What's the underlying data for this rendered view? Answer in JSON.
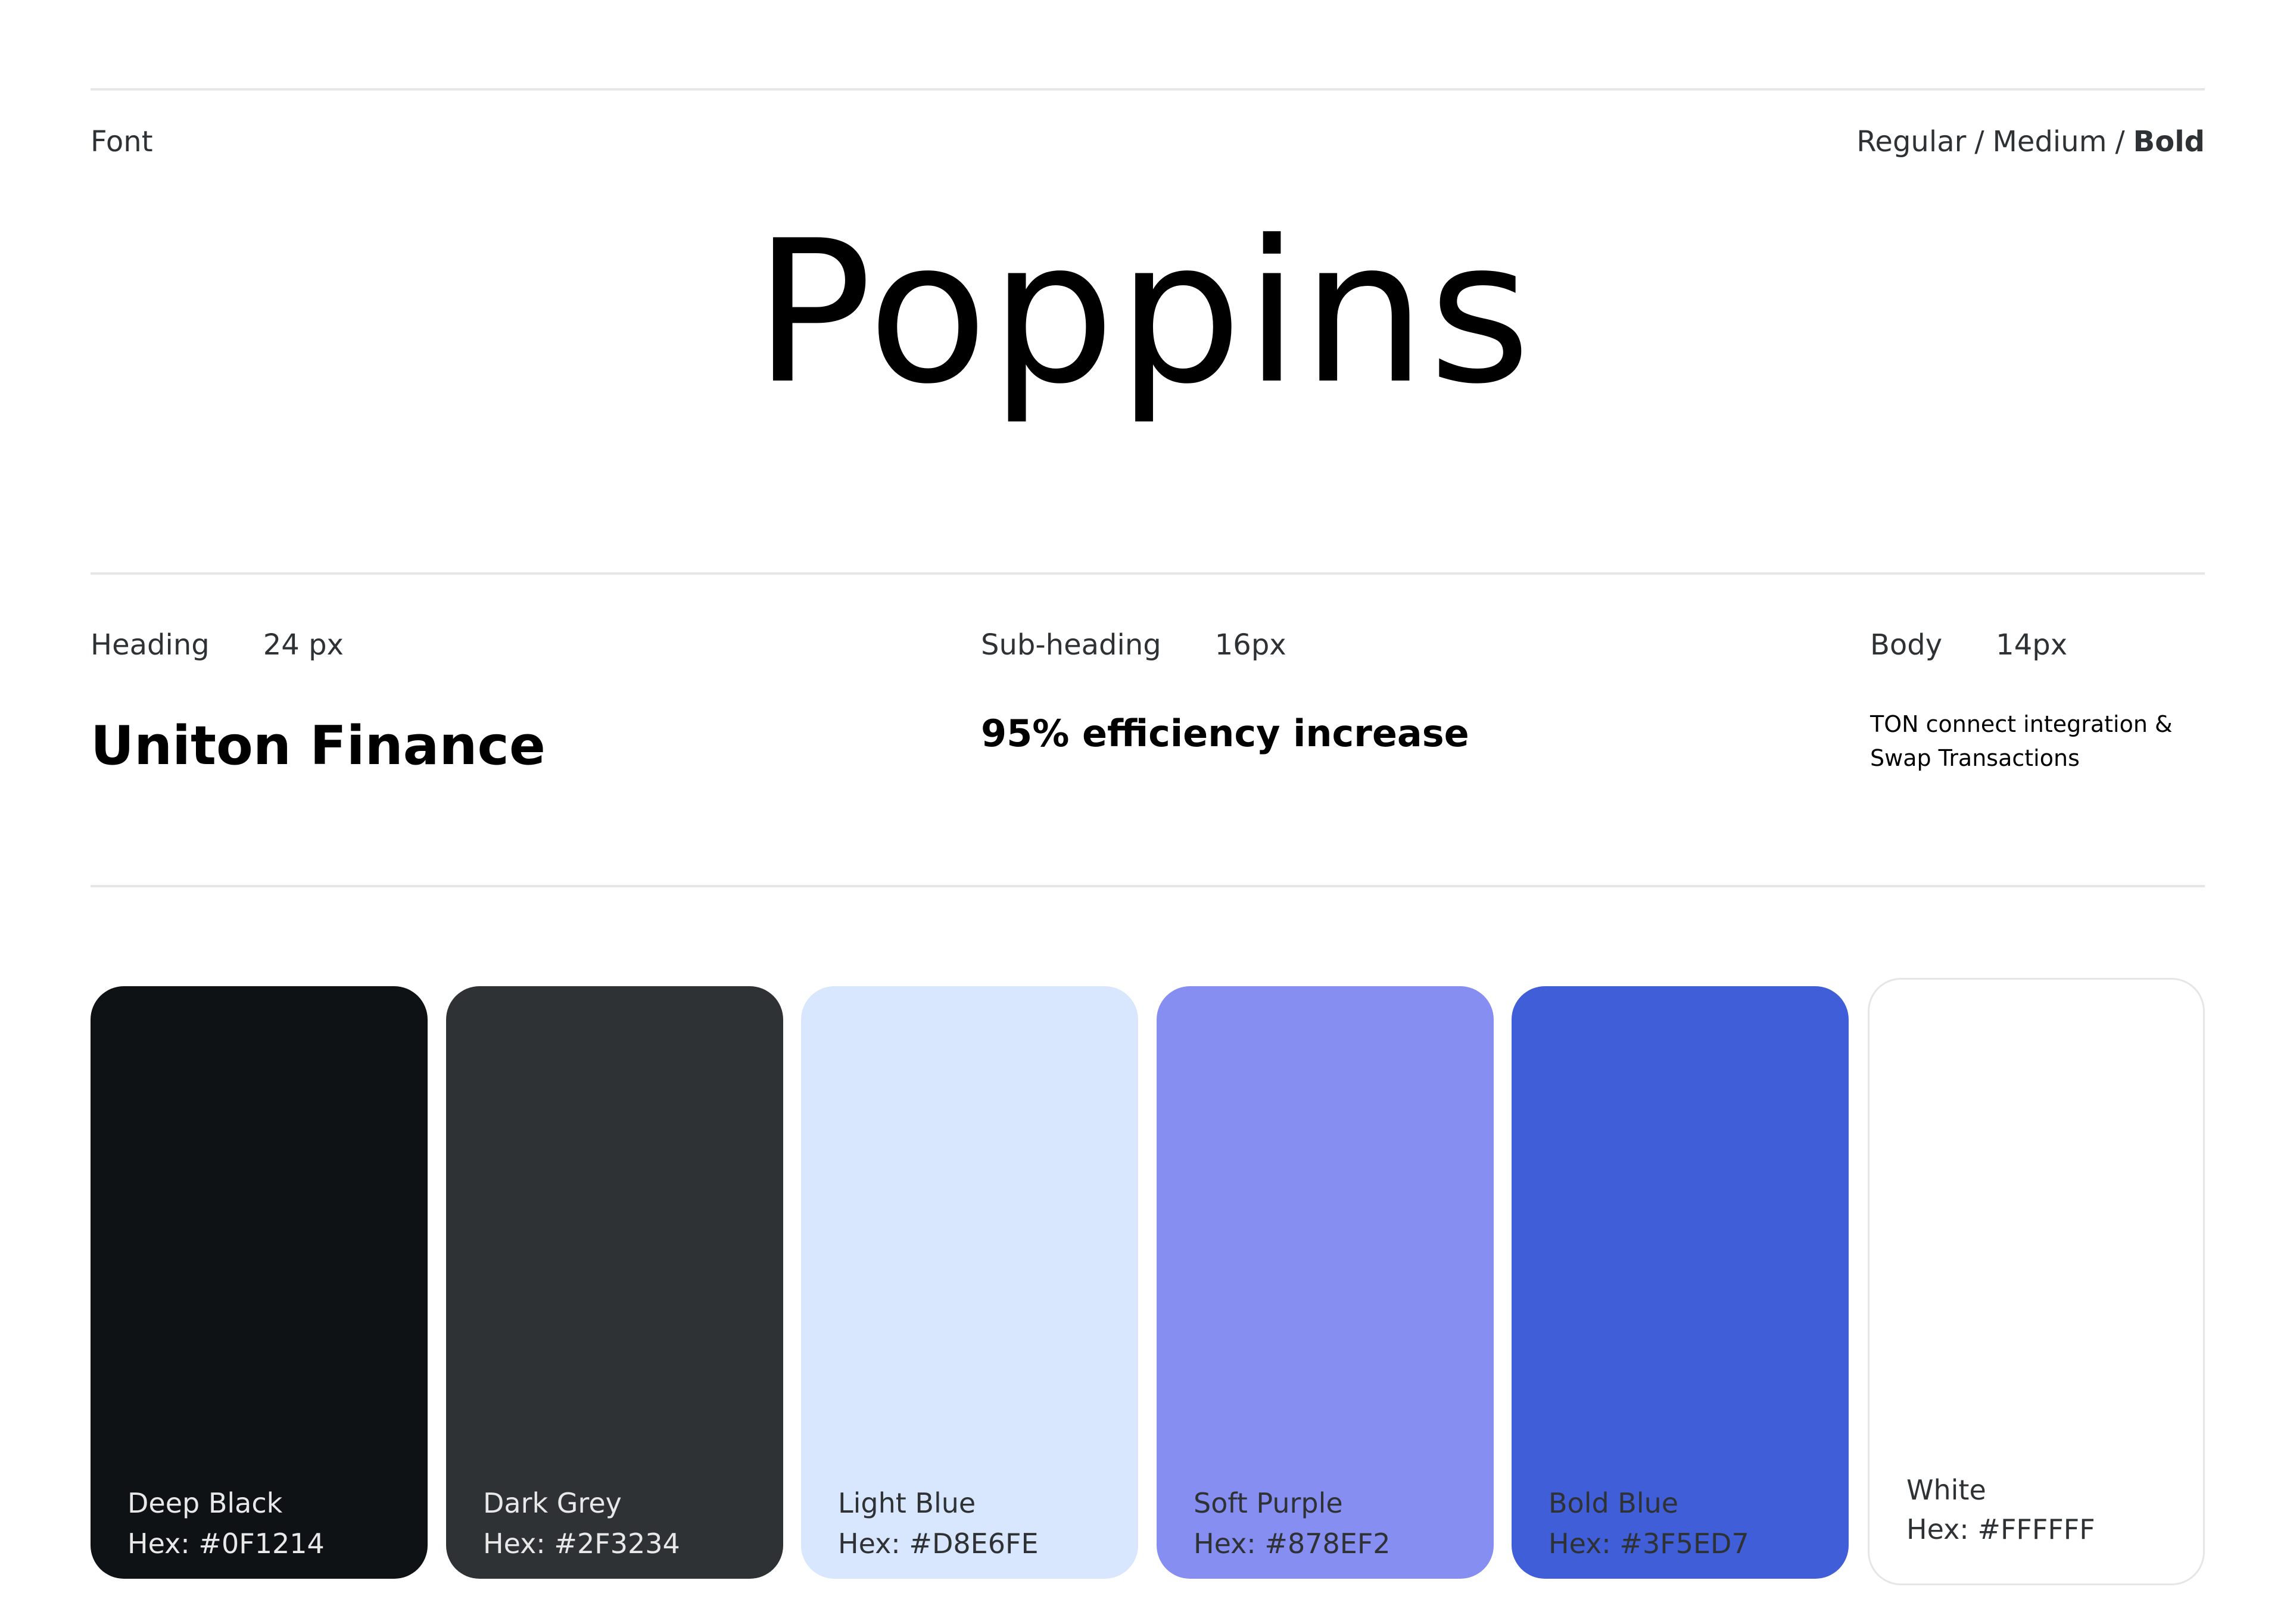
{
  "font_section": {
    "label": "Font",
    "weights": {
      "regular": "Regular",
      "medium": "Medium",
      "bold": "Bold",
      "separator": "/"
    },
    "font_name": "Poppins"
  },
  "typography": {
    "heading": {
      "label": "Heading",
      "size": "24 px",
      "sample": "Uniton Finance"
    },
    "subheading": {
      "label": "Sub-heading",
      "size": "16px",
      "sample": "95% efficiency increase"
    },
    "body": {
      "label": "Body",
      "size": "14px",
      "sample": "TON connect integration & Swap Transactions"
    }
  },
  "colors": [
    {
      "name": "Deep Black",
      "hex_label": "Hex: #0F1214",
      "hex": "#0F1214"
    },
    {
      "name": "Dark Grey",
      "hex_label": "Hex: #2F3234",
      "hex": "#2F3234"
    },
    {
      "name": "Light Blue",
      "hex_label": "Hex: #D8E6FE",
      "hex": "#D8E6FE"
    },
    {
      "name": "Soft Purple",
      "hex_label": "Hex: #878EF2",
      "hex": "#878EF2"
    },
    {
      "name": "Bold Blue",
      "hex_label": "Hex: #3F5ED7",
      "hex": "#3F5ED7"
    },
    {
      "name": "White",
      "hex_label": "Hex: #FFFFFF",
      "hex": "#FFFFFF"
    }
  ]
}
